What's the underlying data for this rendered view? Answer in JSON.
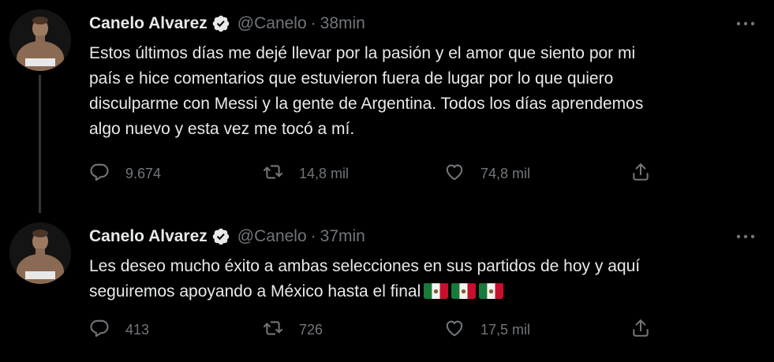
{
  "tweets": [
    {
      "name": "Canelo Alvarez",
      "handle": "@Canelo",
      "separator": "·",
      "time": "38min",
      "text": "Estos últimos días me dejé llevar por la pasión y el amor que siento por mi\npaís e hice comentarios que estuvieron fuera de lugar por lo que quiero\ndisculparme con Messi y la gente de Argentina. Todos los días aprendemos\nalgo nuevo y esta vez me tocó a mí.",
      "replies": "9.674",
      "retweets": "14,8 mil",
      "likes": "74,8 mil"
    },
    {
      "name": "Canelo Alvarez",
      "handle": "@Canelo",
      "separator": "·",
      "time": "37min",
      "text": "Les deseo mucho éxito a ambas selecciones en sus partidos de hoy y aquí\nseguiremos apoyando a México hasta el final",
      "flags": [
        "mexico-flag",
        "mexico-flag",
        "mexico-flag"
      ],
      "replies": "413",
      "retweets": "726",
      "likes": "17,5 mil"
    }
  ],
  "colors": {
    "background": "#000000",
    "text": "#e7e9ea",
    "secondary": "#71767b",
    "thread_line": "#333639",
    "verified_badge": "#e7e9ea"
  },
  "icons": [
    "verified-icon",
    "more-icon",
    "reply-icon",
    "retweet-icon",
    "like-icon",
    "share-icon",
    "mexico-flag-icon"
  ]
}
